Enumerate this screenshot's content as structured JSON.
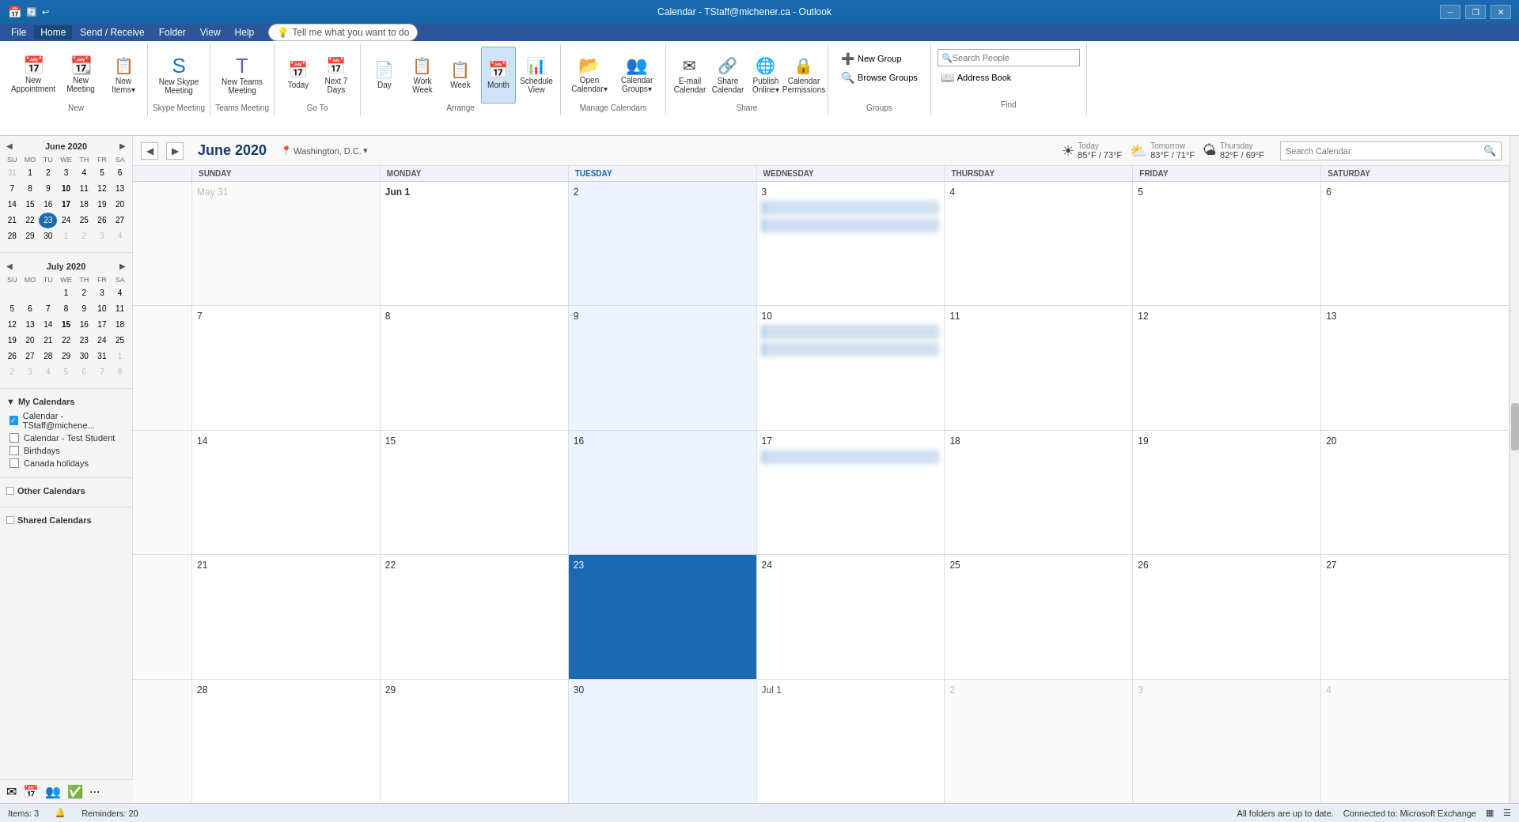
{
  "window": {
    "title": "Calendar - TStaff@michener.ca - Outlook"
  },
  "titlebar": {
    "title": "Calendar - TStaff@michener.ca - Outlook",
    "minimize": "─",
    "restore": "❐",
    "close": "✕"
  },
  "menubar": {
    "items": [
      "File",
      "Home",
      "Send / Receive",
      "Folder",
      "View",
      "Help"
    ]
  },
  "ribbon": {
    "tabs": [
      "File",
      "Home",
      "Send / Receive",
      "Folder",
      "View",
      "Help"
    ],
    "active_tab": "Home",
    "groups": {
      "new": {
        "label": "New",
        "buttons": [
          {
            "id": "new-appointment",
            "label": "New\nAppointment",
            "icon": "📅"
          },
          {
            "id": "new-meeting",
            "label": "New\nMeeting",
            "icon": "📆"
          },
          {
            "id": "new-items",
            "label": "New\nItems",
            "icon": "📋"
          }
        ]
      },
      "skype_meeting": {
        "label": "Skype Meeting",
        "buttons": [
          {
            "id": "new-skype-meeting",
            "label": "New Skype\nMeeting",
            "icon": "🔵"
          }
        ]
      },
      "teams_meeting": {
        "label": "Teams Meeting",
        "buttons": [
          {
            "id": "new-teams-meeting",
            "label": "New Teams\nMeeting",
            "icon": "💜"
          }
        ]
      },
      "go_to": {
        "label": "Go To",
        "buttons": [
          {
            "id": "today",
            "label": "Today",
            "icon": "📅"
          },
          {
            "id": "next-7-days",
            "label": "Next 7\nDays",
            "icon": "📅"
          }
        ]
      },
      "arrange": {
        "label": "Arrange",
        "buttons": [
          {
            "id": "day-view",
            "label": "Day",
            "icon": "📄"
          },
          {
            "id": "work-week-view",
            "label": "Work\nWeek",
            "icon": "📋"
          },
          {
            "id": "week-view",
            "label": "Week",
            "icon": "📋"
          },
          {
            "id": "month-view",
            "label": "Month",
            "icon": "📅",
            "active": true
          },
          {
            "id": "schedule-view",
            "label": "Schedule\nView",
            "icon": "📊"
          }
        ]
      },
      "manage_calendars": {
        "label": "Manage Calendars",
        "buttons": [
          {
            "id": "open-calendar",
            "label": "Open\nCalendar",
            "icon": "📂"
          },
          {
            "id": "calendar-groups",
            "label": "Calendar\nGroups",
            "icon": "👥"
          }
        ]
      },
      "share": {
        "label": "Share",
        "buttons": [
          {
            "id": "email-calendar",
            "label": "E-mail\nCalendar",
            "icon": "✉"
          },
          {
            "id": "share-calendar",
            "label": "Share\nCalendar",
            "icon": "🔗"
          },
          {
            "id": "publish-online",
            "label": "Publish\nOnline",
            "icon": "🌐"
          },
          {
            "id": "calendar-permissions",
            "label": "Calendar\nPermissions",
            "icon": "🔒"
          }
        ]
      },
      "groups_section": {
        "label": "Groups",
        "buttons": [
          {
            "id": "new-group",
            "label": "New Group",
            "icon": "➕"
          },
          {
            "id": "browse-groups",
            "label": "Browse Groups",
            "icon": "🔍"
          }
        ]
      },
      "find": {
        "label": "Find",
        "search_people_placeholder": "Search People",
        "address_book_label": "Address Book"
      }
    },
    "tell_me": "Tell me what you want to do"
  },
  "mini_calendars": {
    "june": {
      "month_year": "June 2020",
      "days_of_week": [
        "SU",
        "MO",
        "TU",
        "WE",
        "TH",
        "FR",
        "SA"
      ],
      "weeks": [
        [
          {
            "day": 31,
            "other": true
          },
          {
            "day": 1
          },
          {
            "day": 2
          },
          {
            "day": 3
          },
          {
            "day": 4
          },
          {
            "day": 5
          },
          {
            "day": 6
          }
        ],
        [
          {
            "day": 7
          },
          {
            "day": 8
          },
          {
            "day": 9
          },
          {
            "day": 10,
            "bold": true
          },
          {
            "day": 11
          },
          {
            "day": 12
          },
          {
            "day": 13
          }
        ],
        [
          {
            "day": 14
          },
          {
            "day": 15
          },
          {
            "day": 16
          },
          {
            "day": 17,
            "bold": true
          },
          {
            "day": 18
          },
          {
            "day": 19
          },
          {
            "day": 20
          }
        ],
        [
          {
            "day": 21
          },
          {
            "day": 22
          },
          {
            "day": 23,
            "today": true
          },
          {
            "day": 24
          },
          {
            "day": 25
          },
          {
            "day": 26
          },
          {
            "day": 27
          }
        ],
        [
          {
            "day": 28
          },
          {
            "day": 29
          },
          {
            "day": 30
          },
          {
            "day": 1,
            "other": true
          },
          {
            "day": 2,
            "other": true
          },
          {
            "day": 3,
            "other": true
          },
          {
            "day": 4,
            "other": true
          }
        ]
      ]
    },
    "july": {
      "month_year": "July 2020",
      "days_of_week": [
        "SU",
        "MO",
        "TU",
        "WE",
        "TH",
        "FR",
        "SA"
      ],
      "weeks": [
        [
          {
            "day": "",
            "other": true
          },
          {
            "day": "",
            "other": true
          },
          {
            "day": "",
            "other": true
          },
          {
            "day": 1
          },
          {
            "day": 2
          },
          {
            "day": 3
          },
          {
            "day": 4
          }
        ],
        [
          {
            "day": 5
          },
          {
            "day": 6
          },
          {
            "day": 7
          },
          {
            "day": 8
          },
          {
            "day": 9
          },
          {
            "day": 10
          },
          {
            "day": 11
          }
        ],
        [
          {
            "day": 12
          },
          {
            "day": 13
          },
          {
            "day": 14
          },
          {
            "day": 15,
            "bold": true
          },
          {
            "day": 16
          },
          {
            "day": 17
          },
          {
            "day": 18
          }
        ],
        [
          {
            "day": 19
          },
          {
            "day": 20
          },
          {
            "day": 21
          },
          {
            "day": 22
          },
          {
            "day": 23
          },
          {
            "day": 24
          },
          {
            "day": 25
          }
        ],
        [
          {
            "day": 26
          },
          {
            "day": 27
          },
          {
            "day": 28
          },
          {
            "day": 29
          },
          {
            "day": 30
          },
          {
            "day": 31
          },
          {
            "day": 1,
            "other": true
          }
        ],
        [
          {
            "day": 2,
            "other": true
          },
          {
            "day": 3,
            "other": true
          },
          {
            "day": 4,
            "other": true
          },
          {
            "day": 5,
            "other": true
          },
          {
            "day": 6,
            "other": true
          },
          {
            "day": 7,
            "other": true
          },
          {
            "day": 8,
            "other": true
          }
        ]
      ]
    }
  },
  "my_calendars": {
    "header": "My Calendars",
    "items": [
      {
        "label": "Calendar - TStaff@michene...",
        "checked": true,
        "color": "#2196f3"
      },
      {
        "label": "Calendar - Test Student",
        "checked": false
      },
      {
        "label": "Birthdays",
        "checked": false
      },
      {
        "label": "Canada holidays",
        "checked": false
      }
    ]
  },
  "other_calendars": {
    "header": "Other Calendars",
    "checked": false
  },
  "shared_calendars": {
    "header": "Shared Calendars",
    "checked": false
  },
  "calendar": {
    "title": "June 2020",
    "location": "Washington, D.C.",
    "search_placeholder": "Search Calendar",
    "nav_prev": "◀",
    "nav_next": "▶",
    "weather": {
      "today": {
        "label": "Today",
        "temp": "85°F / 73°F",
        "icon": "☀"
      },
      "tomorrow": {
        "label": "Tomorrow",
        "temp": "83°F / 71°F",
        "icon": "🌤"
      },
      "thursday": {
        "label": "Thursday",
        "temp": "82°F / 69°F",
        "icon": "🌤"
      }
    },
    "days_of_week": [
      "SUNDAY",
      "MONDAY",
      "TUESDAY",
      "WEDNESDAY",
      "THURSDAY",
      "FRIDAY",
      "SATURDAY"
    ],
    "weeks": [
      {
        "week_num": "",
        "days": [
          {
            "date": "May 31",
            "label": "May 31",
            "other": true
          },
          {
            "date": "Jun 1",
            "label": "Jun 1"
          },
          {
            "date": "2",
            "label": "2",
            "tuesday": true
          },
          {
            "date": "3",
            "label": "3",
            "has_event": true
          },
          {
            "date": "4",
            "label": "4"
          },
          {
            "date": "5",
            "label": "5"
          },
          {
            "date": "6",
            "label": "6"
          }
        ]
      },
      {
        "week_num": "",
        "days": [
          {
            "date": "7",
            "label": "7"
          },
          {
            "date": "8",
            "label": "8"
          },
          {
            "date": "9",
            "label": "9",
            "tuesday": true
          },
          {
            "date": "10",
            "label": "10",
            "has_event": true
          },
          {
            "date": "11",
            "label": "11"
          },
          {
            "date": "12",
            "label": "12"
          },
          {
            "date": "13",
            "label": "13"
          }
        ]
      },
      {
        "week_num": "",
        "days": [
          {
            "date": "14",
            "label": "14"
          },
          {
            "date": "15",
            "label": "15"
          },
          {
            "date": "16",
            "label": "16",
            "tuesday": true
          },
          {
            "date": "17",
            "label": "17",
            "has_event": true
          },
          {
            "date": "18",
            "label": "18"
          },
          {
            "date": "19",
            "label": "19"
          },
          {
            "date": "20",
            "label": "20"
          }
        ]
      },
      {
        "week_num": "",
        "days": [
          {
            "date": "21",
            "label": "21"
          },
          {
            "date": "22",
            "label": "22"
          },
          {
            "date": "23",
            "label": "23",
            "today": true,
            "tuesday": true
          },
          {
            "date": "24",
            "label": "24"
          },
          {
            "date": "25",
            "label": "25"
          },
          {
            "date": "26",
            "label": "26"
          },
          {
            "date": "27",
            "label": "27"
          }
        ]
      },
      {
        "week_num": "",
        "days": [
          {
            "date": "28",
            "label": "28"
          },
          {
            "date": "29",
            "label": "29"
          },
          {
            "date": "30",
            "label": "30",
            "tuesday": true
          },
          {
            "date": "Jul 1",
            "label": "Jul 1"
          },
          {
            "date": "2",
            "label": "2",
            "other": true
          },
          {
            "date": "3",
            "label": "3",
            "other": true
          },
          {
            "date": "4",
            "label": "4",
            "other": true
          }
        ]
      }
    ]
  },
  "statusbar": {
    "items": "3",
    "reminders": "20",
    "message": "All folders are up to date.",
    "connected": "Connected to: Microsoft Exchange"
  }
}
